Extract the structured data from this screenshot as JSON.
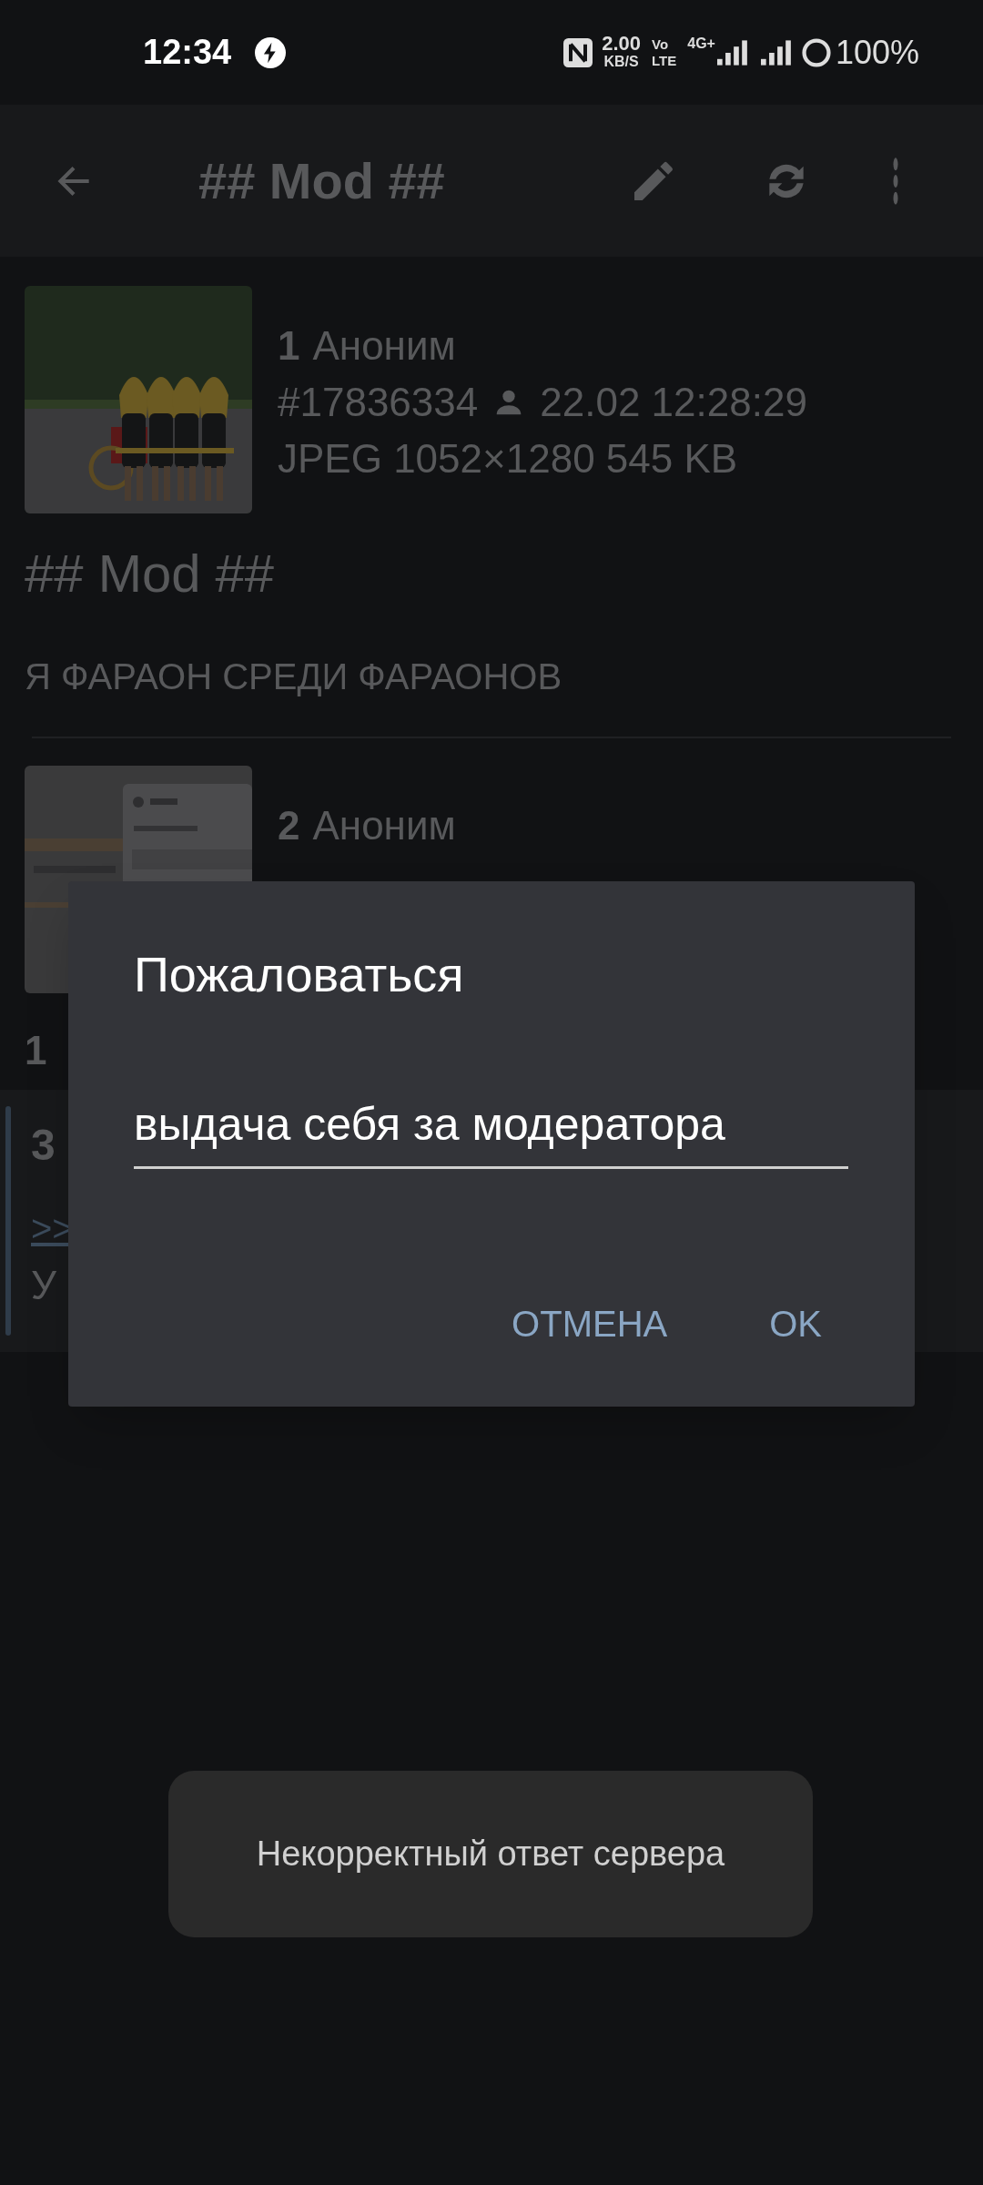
{
  "status_bar": {
    "time": "12:34",
    "speed": "2.00",
    "speed_unit": "KB/S",
    "volte_top": "Vo",
    "volte_bottom": "LTE",
    "network": "4G+",
    "battery": "100%"
  },
  "toolbar": {
    "title": "## Mod ##"
  },
  "posts": [
    {
      "number": "1",
      "author": "Аноним",
      "post_id": "#17836334",
      "date": "22.02 12:28:29",
      "file_info": "JPEG 1052×1280 545 KB",
      "subject": "## Mod ##",
      "body": "Я ФАРАОН СРЕДИ ФАРАОНОВ",
      "highlighted": false
    },
    {
      "number": "2",
      "author": "Аноним",
      "body": "1",
      "highlighted": false
    },
    {
      "number": "3",
      "reply_link": ">>",
      "body": "У",
      "highlighted": true
    }
  ],
  "dialog": {
    "title": "Пожаловаться",
    "value": "выдача себя за модератора",
    "buttons": [
      "ОТМЕНА",
      "OK"
    ]
  },
  "toast": {
    "text": "Некорректный ответ сервера"
  }
}
